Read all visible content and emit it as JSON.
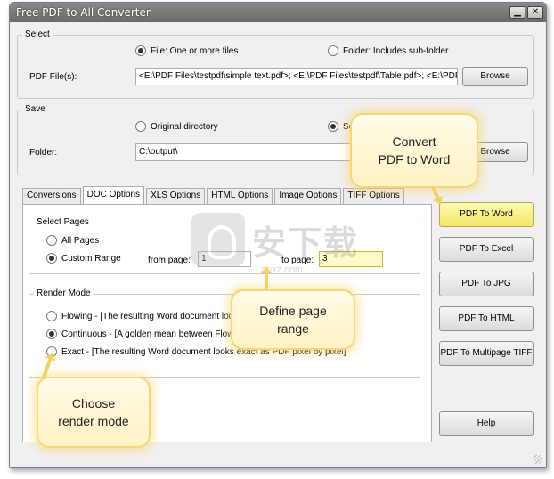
{
  "window": {
    "title": "Free PDF to All Converter",
    "minimize": "▁",
    "close": "✕"
  },
  "select": {
    "legend": "Select",
    "option_file": "File:  One or more files",
    "option_folder": "Folder: Includes sub-folder",
    "files_label": "PDF File(s):",
    "files_value": "<E:\\PDF Files\\testpdf\\simple text.pdf>; <E:\\PDF Files\\testpdf\\Table.pdf>; <E:\\PDF",
    "browse": "Browse"
  },
  "save": {
    "legend": "Save",
    "option_original": "Original directory",
    "option_selected": "Se",
    "folder_label": "Folder:",
    "folder_value": "C:\\output\\",
    "browse": "Browse"
  },
  "tabs": [
    "Conversions",
    "DOC Options",
    "XLS Options",
    "HTML Options",
    "Image Options",
    "TIFF Options"
  ],
  "active_tab": "DOC Options",
  "select_pages": {
    "legend": "Select Pages",
    "all_pages": "All Pages",
    "custom_range": "Custom Range",
    "from_label": "from page:",
    "from_value": "1",
    "to_label": "to page:",
    "to_value": "3"
  },
  "render_mode": {
    "legend": "Render Mode",
    "flowing": "Flowing - [The resulting Word document loo",
    "continuous": "Continuous - [A golden mean between Flow",
    "exact": "Exact - [The resulting Word document looks exact as PDF pixel by pixel]"
  },
  "side_buttons": [
    "PDF To Word",
    "PDF To Excel",
    "PDF To JPG",
    "PDF To HTML",
    "PDF To Multipage TIFF",
    "Help"
  ],
  "callouts": {
    "convert": [
      "Convert",
      "PDF to Word"
    ],
    "range": [
      "Define page",
      "range"
    ],
    "render": [
      "Choose",
      "render mode"
    ]
  },
  "watermark": {
    "text": "安下载",
    "sub": "anxz.com"
  }
}
